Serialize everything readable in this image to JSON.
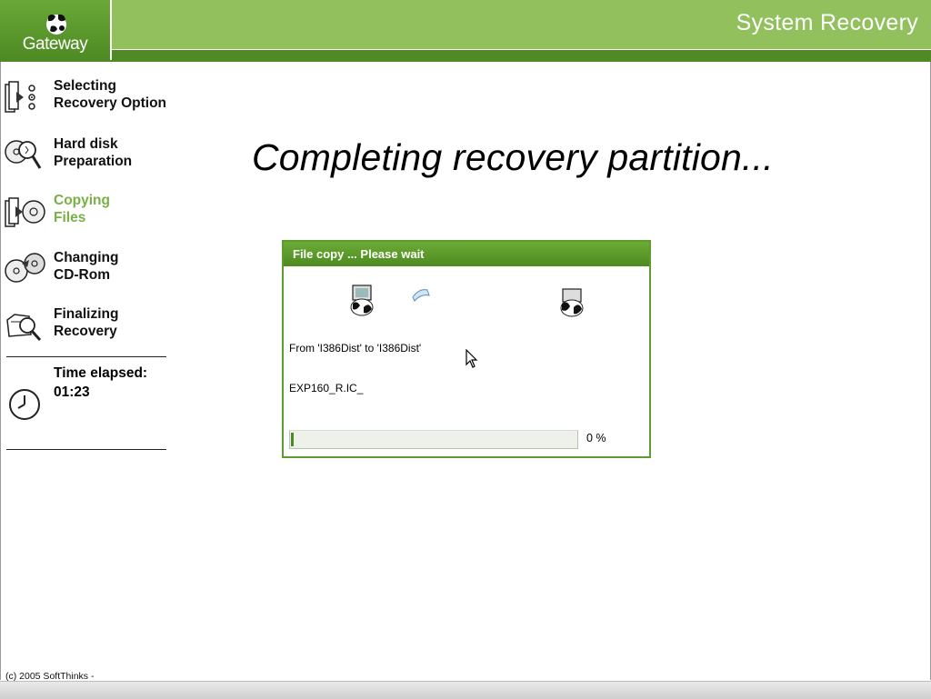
{
  "header": {
    "logo_text": "Gateway",
    "app_title": "System Recovery"
  },
  "sidebar": {
    "steps": [
      {
        "label": "Selecting\nRecovery Option",
        "icon": "selecting-option-icon",
        "state": "done"
      },
      {
        "label": "Hard disk\nPreparation",
        "icon": "disk-magnifier-icon",
        "state": "done"
      },
      {
        "label": "Copying\nFiles",
        "icon": "copying-files-icon",
        "state": "active"
      },
      {
        "label": "Changing\nCD-Rom",
        "icon": "change-cd-icon",
        "state": "pending"
      },
      {
        "label": "Finalizing\nRecovery",
        "icon": "finalizing-icon",
        "state": "pending"
      }
    ],
    "elapsed_label": "Time elapsed:",
    "elapsed_value": "01:23"
  },
  "main": {
    "heading": "Completing recovery partition..."
  },
  "dialog": {
    "title": "File copy ... Please wait",
    "copy_path": "From 'I386Dist' to 'I386Dist'",
    "current_file": "EXP160_R.IC_",
    "progress_fraction": 0.01,
    "progress_text": "0 %"
  },
  "footer": {
    "copyright": "(c) 2005 SoftThinks  -"
  },
  "colors": {
    "brand_green": "#92c05c",
    "dark_green": "#4f8a25",
    "active_step": "#79b045"
  }
}
